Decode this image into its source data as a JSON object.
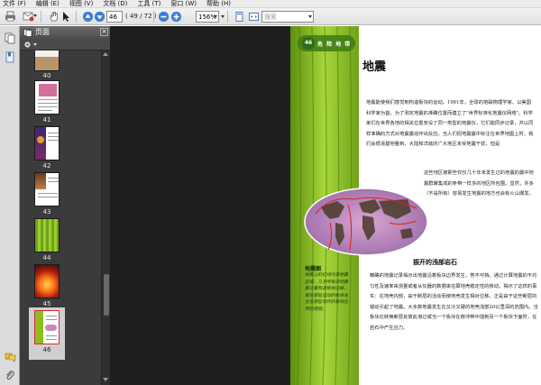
{
  "menu": {
    "items": [
      "文件 (F)",
      "编辑 (E)",
      "视图 (V)",
      "文档 (D)",
      "工具 (T)",
      "窗口 (W)",
      "帮助 (H)"
    ]
  },
  "toolbar": {
    "page_current": "46",
    "page_total": "( 49 / 72 )",
    "zoom": "156%",
    "search_placeholder": "搜索"
  },
  "sidebar": {
    "panel_title": "页面",
    "thumbnails": [
      {
        "label": "40",
        "color": "#9a7a6a"
      },
      {
        "label": "41",
        "color": "#c06a8a"
      },
      {
        "label": "42",
        "color": "#3b2a6b"
      },
      {
        "label": "43",
        "color": "#8a5a3a"
      },
      {
        "label": "44",
        "color": "#7db222"
      },
      {
        "label": "45",
        "color": "#c0301a"
      },
      {
        "label": "46",
        "color": "#8dbd20"
      }
    ]
  },
  "document": {
    "page_number": "46",
    "header_title": "危 险 地 带",
    "headline": "地震",
    "paragraph1": "地震能使我们感觉到构造板块的运动。1961年，全球的地磁物理学家、以美国科学家为首，为了测定地震的准确位置而建立了\"世界标准化地震仪网络\"。科学家们在世界各地的相关位置安设了同一类型的地震仪，它们能同步记录，并以同样准确的方式对地震震动作出反应。当人们把地震震中标注在世界地图上时，我们会很清楚地看到，大陆和洋底的广大地区未受地震干扰，但是",
    "paragraph2": "这些地区被那些仅仅几十年未发生过的地震的震中地震群聚集成的条带一样多的地区所包围，显然，许多（不是所有）容易发生地震的地方也会有火山爆发。",
    "subhead": "振开的浅部岩石",
    "paragraph3": "精确的地震记录揭示出地震沿着板块边界发生，势不可挡。通过计算地震的不均匀性及速率来测量或者从仪器的数据来估算地壳稳定性的移动，揭示了这样的事实：在地壳内部，由于断层的活动而使地壳发生相对位移，正是由于这些断层的错动引起了地震。大多数地震发生在又冷又硬的地壳浅部20公里深的范围内。当板块在转换断层处彼此滑过或当一个板块在俯冲带中插到另一个板块下面时，在岩石中产生应力。",
    "caption_title": "地震图",
    "caption_body": "地图上的红线代表地震区域，几乎所有的地震都沿着构造板块边缘，或在那些运动的板块发生在那些动作的板块边界的两侧。"
  },
  "colors": {
    "accent": "#8dbd20",
    "dark_bg": "#1e1e1e",
    "panel_bg": "#3b3b3b"
  }
}
